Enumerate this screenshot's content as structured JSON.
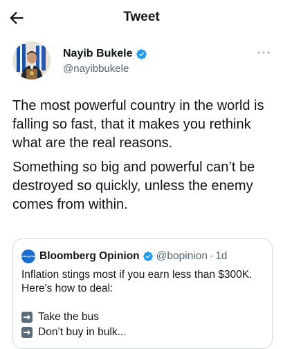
{
  "header": {
    "title": "Tweet",
    "back_icon": "arrow-left-icon"
  },
  "author": {
    "name": "Nayib Bukele",
    "handle": "@nayibbukele",
    "verified_color": "#1d9bf0",
    "more_icon": "more-dots-icon"
  },
  "tweet": {
    "paragraphs": [
      "The most powerful country in the world is falling so fast, that it makes you rethink what are the real reasons.",
      "Something so big and powerful can’t be destroyed so quickly, unless the enemy comes from within."
    ]
  },
  "quoted": {
    "logo_text": "Bloomberg Opinion",
    "name": "Bloomberg Opinion",
    "handle": "@bopinion",
    "separator": "·",
    "time": "1d",
    "text_lines": [
      "Inflation stings most if you earn less than $300K.",
      "Here's how to deal:"
    ],
    "items": [
      {
        "icon": "right-arrow-emoji-icon",
        "label": "Take the bus"
      },
      {
        "icon": "right-arrow-emoji-icon",
        "label": "Don’t buy in bulk..."
      }
    ]
  },
  "colors": {
    "accent": "#1d9bf0",
    "secondary_text": "#536471",
    "border": "#cfd9de"
  }
}
